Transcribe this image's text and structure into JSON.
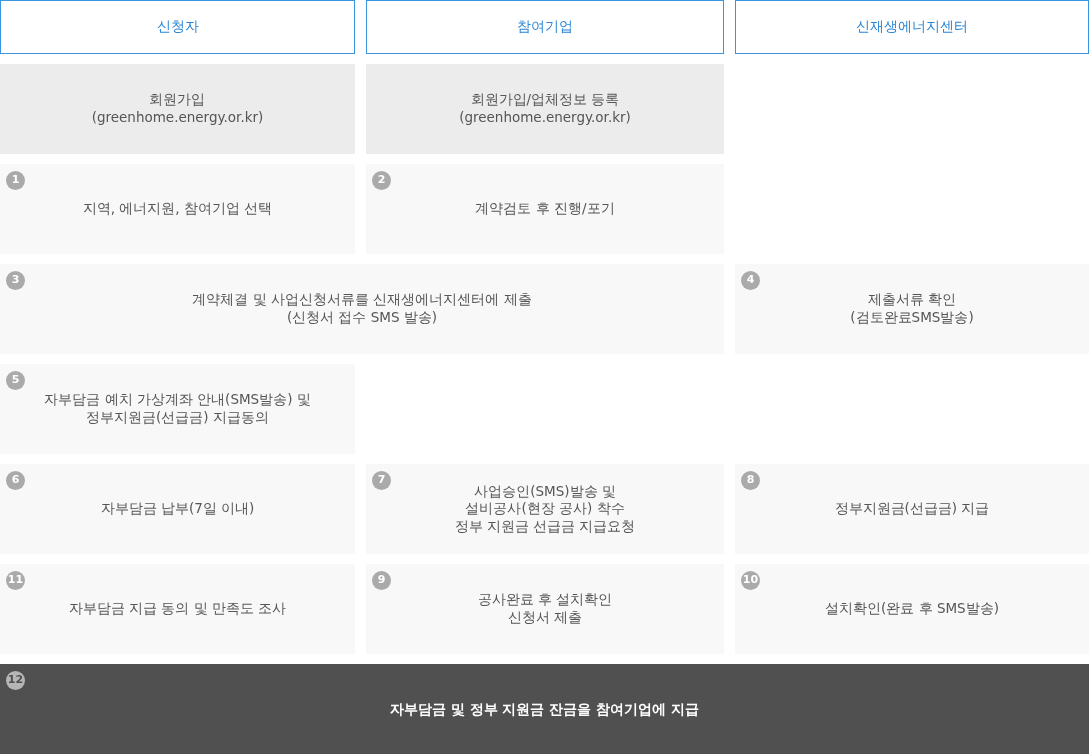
{
  "headers": [
    {
      "label": "신청자"
    },
    {
      "label": "참여기업"
    },
    {
      "label": "신재생에너지센터"
    }
  ],
  "rows": [
    {
      "cells": [
        {
          "kind": "signup",
          "text": "회원가입\n(greenhome.energy.or.kr)"
        },
        {
          "kind": "signup",
          "text": "회원가입/업체정보 등록\n(greenhome.energy.or.kr)"
        },
        {
          "kind": "blank"
        }
      ]
    },
    {
      "cells": [
        {
          "kind": "step",
          "number": "1",
          "text": "지역, 에너지원, 참여기업 선택"
        },
        {
          "kind": "step",
          "number": "2",
          "text": "계약검토 후 진행/포기"
        },
        {
          "kind": "blank"
        }
      ]
    },
    {
      "cells": [
        {
          "kind": "step",
          "wide": true,
          "number": "3",
          "text": "계약체결 및 사업신청서류를 신재생에너지센터에 제출\n(신청서 접수 SMS 발송)"
        },
        {
          "kind": "step",
          "number": "4",
          "text": "제출서류 확인\n(검토완료SMS발송)"
        }
      ]
    },
    {
      "cells": [
        {
          "kind": "step",
          "number": "5",
          "text": "자부담금 예치 가상계좌 안내(SMS발송) 및\n정부지원금(선급금) 지급동의"
        },
        {
          "kind": "blank"
        },
        {
          "kind": "blank"
        }
      ]
    },
    {
      "cells": [
        {
          "kind": "step",
          "number": "6",
          "text": "자부담금 납부(7일 이내)"
        },
        {
          "kind": "step",
          "number": "7",
          "text": "사업승인(SMS)발송 및\n설비공사(현장 공사) 착수\n정부 지원금 선급금 지급요청"
        },
        {
          "kind": "step",
          "number": "8",
          "text": "정부지원금(선급금) 지급"
        }
      ]
    },
    {
      "cells": [
        {
          "kind": "step",
          "number": "11",
          "text": "자부담금 지급 동의 및 만족도 조사"
        },
        {
          "kind": "step",
          "number": "9",
          "text": "공사완료 후 설치확인\n신청서 제출"
        },
        {
          "kind": "step",
          "number": "10",
          "text": "설치확인(완료 후 SMS발송)"
        }
      ]
    },
    {
      "cells": [
        {
          "kind": "final",
          "number": "12",
          "text": "자부담금 및 정부 지원금 잔금을 참여기업에 지급"
        }
      ]
    }
  ]
}
